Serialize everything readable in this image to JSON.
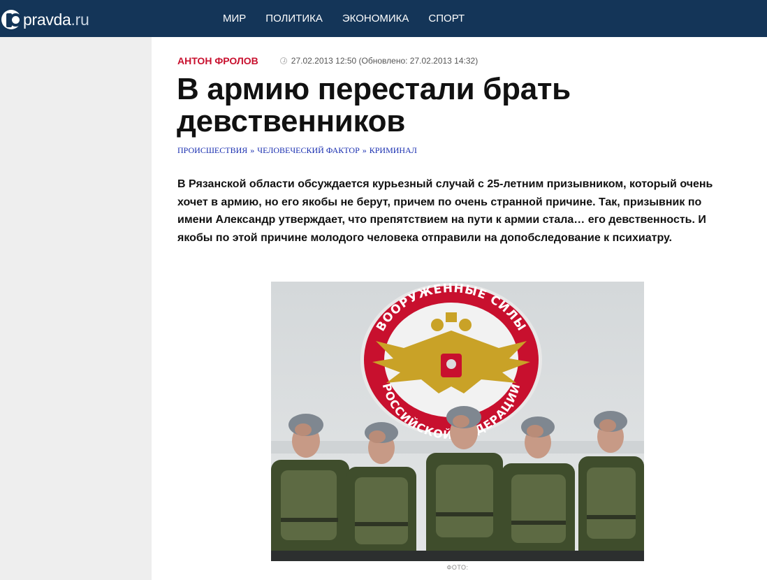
{
  "header": {
    "logo": {
      "name": "pravda",
      "domain": ".ru"
    },
    "nav": [
      "МИР",
      "ПОЛИТИКА",
      "ЭКОНОМИКА",
      "СПОРТ"
    ]
  },
  "article": {
    "author": "АНТОН ФРОЛОВ",
    "datetime": "27.02.2013 12:50 (Обновлено: 27.02.2013 14:32)",
    "title": "В армию перестали брать девственников",
    "breadcrumbs": [
      "ПРОИСШЕСТВИЯ",
      "ЧЕЛОВЕЧЕСКИЙ ФАКТОР",
      "КРИМИНАЛ"
    ],
    "breadcrumb_separator": "»",
    "lead": "В Рязанской области обсуждается курьезный случай с 25-летним призывником, который очень хочет в армию, но его якобы не берут, причем по очень странной причине. Так, призывник по имени Александр утверждает, что препятствием на пути к армии стала… его девственность. И якобы по этой причине молодого человека отправили на допобследование к психиатру.",
    "photo": {
      "emblem_text_top": "ВООРУЖЕННЫЕ СИЛЫ",
      "emblem_text_bottom": "РОССИЙСКОЙ ФЕДЕРАЦИИ"
    },
    "caption": "ФОТО:"
  },
  "colors": {
    "header_bg": "#143558",
    "author_red": "#c8102e",
    "link_blue": "#1a2fb0",
    "page_bg": "#eeeeee"
  },
  "icons": [
    "logo-mark-icon",
    "clock-icon"
  ]
}
